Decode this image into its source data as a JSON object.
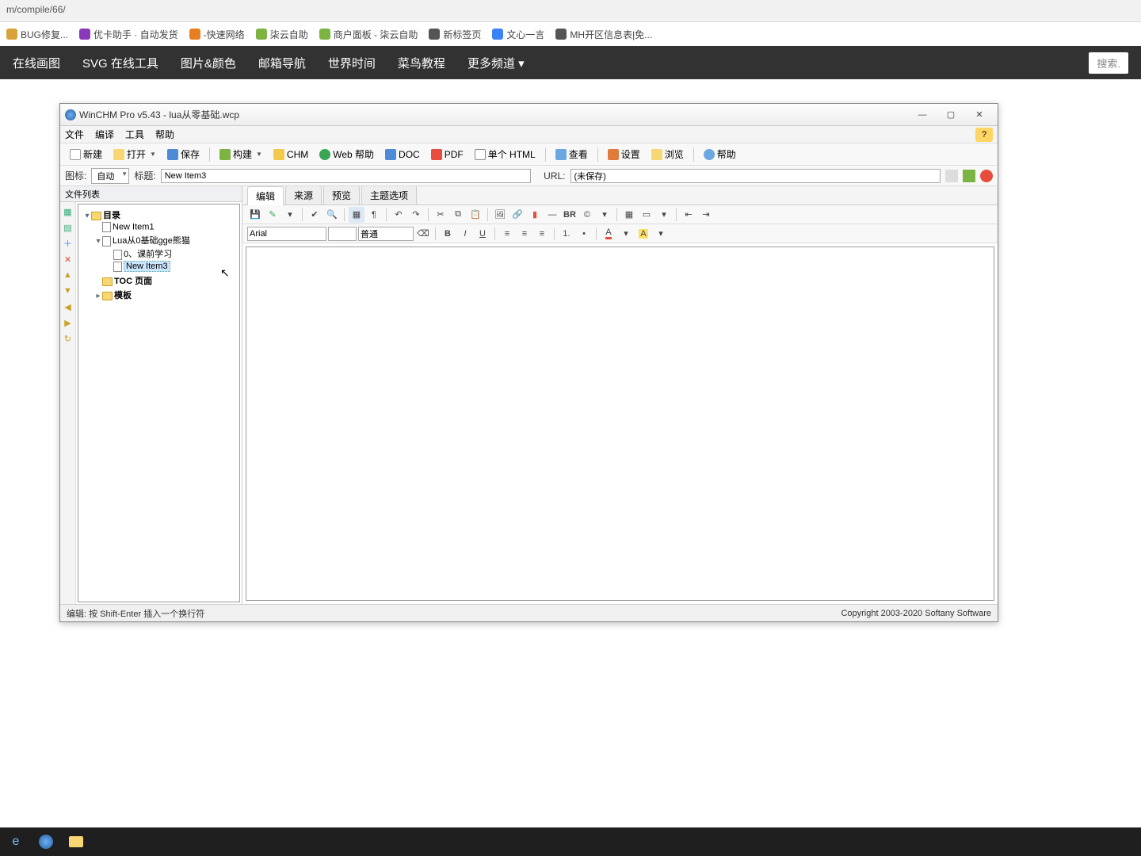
{
  "browser": {
    "url_fragment": "m/compile/66/",
    "bookmarks": [
      {
        "label": "BUG修复...",
        "color": "#d8a33a"
      },
      {
        "label": "优卡助手 · 自动发货",
        "color": "#8a3ab9"
      },
      {
        "label": "-快速网络",
        "color": "#e67e22"
      },
      {
        "label": "柒云自助",
        "color": "#7cb342"
      },
      {
        "label": "商户面板 - 柒云自助",
        "color": "#7cb342"
      },
      {
        "label": "新标签页",
        "color": "#555"
      },
      {
        "label": "文心一言",
        "color": "#3b82f6"
      },
      {
        "label": "MH开区信息表|免...",
        "color": "#555"
      }
    ]
  },
  "nav": {
    "items": [
      "在线画图",
      "SVG 在线工具",
      "图片&颜色",
      "邮箱导航",
      "世界时间",
      "菜鸟教程",
      "更多频道 ▾"
    ],
    "search_placeholder": "搜索."
  },
  "app": {
    "title": "WinCHM Pro v5.43 - lua从零基础.wcp",
    "menus": [
      "文件",
      "编译",
      "工具",
      "帮助"
    ],
    "toolbar": [
      {
        "icon": "#fff",
        "label": "新建"
      },
      {
        "icon": "#f7d774",
        "label": "打开",
        "dd": true
      },
      {
        "icon": "#4e8bd6",
        "label": "保存"
      },
      {
        "sep": true
      },
      {
        "icon": "#7cb342",
        "label": "构建",
        "dd": true
      },
      {
        "icon": "#f2c94c",
        "label": "CHM"
      },
      {
        "icon": "#3aa655",
        "label": "Web 帮助"
      },
      {
        "icon": "#4e8bd6",
        "label": "DOC"
      },
      {
        "icon": "#e74c3c",
        "label": "PDF"
      },
      {
        "icon": "#555",
        "label": "单个 HTML"
      },
      {
        "sep": true
      },
      {
        "icon": "#6aa7e0",
        "label": "查看"
      },
      {
        "sep": true
      },
      {
        "icon": "#e07b39",
        "label": "设置"
      },
      {
        "icon": "#f7d774",
        "label": "浏览"
      },
      {
        "sep": true
      },
      {
        "icon": "#6aa7e0",
        "label": "帮助"
      }
    ],
    "prop": {
      "icon_label": "图标:",
      "icon_value": "自动",
      "title_label": "标题:",
      "title_value": "New Item3",
      "url_label": "URL:",
      "url_value": "(未保存)"
    },
    "left_header": "文件列表",
    "tree": {
      "root": "目录",
      "n1": "New Item1",
      "n2": "Lua从0基础gge熊猫",
      "n3": "0、课前学习",
      "n4": "New Item3",
      "toc": "TOC 页面",
      "tpl": "模板"
    },
    "tabs": [
      "编辑",
      "来源",
      "预览",
      "主题选项"
    ],
    "font_name": "Arial",
    "font_size": "",
    "font_style": "普通",
    "status_left": "编辑: 按 Shift-Enter 插入一个换行符",
    "status_right": "Copyright 2003-2020 Softany Software"
  }
}
